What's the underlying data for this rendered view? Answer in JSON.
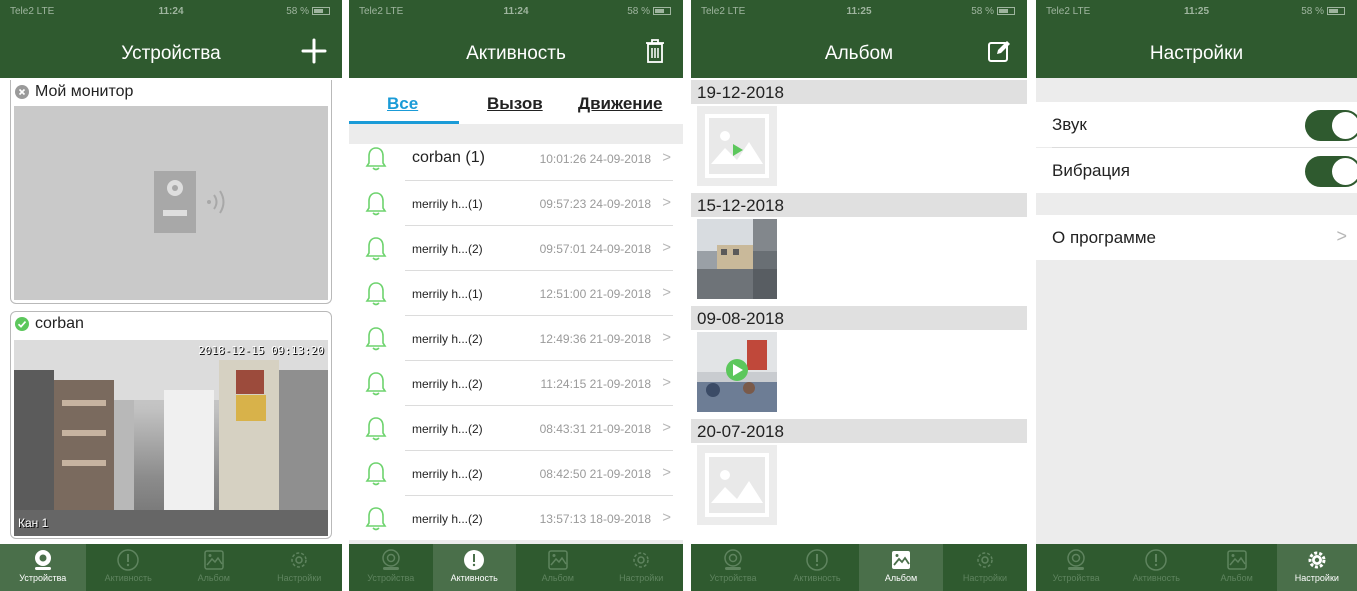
{
  "status_bar": {
    "carrier": "Tele2 LTE",
    "battery": "58 %"
  },
  "tabs": [
    "Устройства",
    "Активность",
    "Альбом",
    "Настройки"
  ],
  "colors": {
    "primary": "#2f5a2f",
    "tab_active": "#4a6f4a",
    "accent": "#1a9bd7",
    "bell": "#6ed36e",
    "online": "#5cc75c",
    "offline": "#9a9a9a"
  },
  "devices_screen": {
    "time": "11:24",
    "title": "Устройства",
    "add_icon": "plus-icon",
    "devices": [
      {
        "name": "Мой монитор",
        "status": "offline"
      },
      {
        "name": "corban",
        "status": "online",
        "timestamp": "2018-12-15 09:13:20",
        "channel": "Кан 1"
      }
    ]
  },
  "activity_screen": {
    "time": "11:24",
    "title": "Активность",
    "delete_icon": "trash-icon",
    "filters": [
      "Все",
      "Вызов",
      "Движение"
    ],
    "items": [
      {
        "name": "corban (1)",
        "time": "10:01:26 24-09-2018"
      },
      {
        "name": "merrily h...(1)",
        "time": "09:57:23 24-09-2018"
      },
      {
        "name": "merrily h...(2)",
        "time": "09:57:01 24-09-2018"
      },
      {
        "name": "merrily h...(1)",
        "time": "12:51:00 21-09-2018"
      },
      {
        "name": "merrily h...(2)",
        "time": "12:49:36 21-09-2018"
      },
      {
        "name": "merrily h...(2)",
        "time": "11:24:15 21-09-2018"
      },
      {
        "name": "merrily h...(2)",
        "time": "08:43:31 21-09-2018"
      },
      {
        "name": "merrily h...(2)",
        "time": "08:42:50 21-09-2018"
      },
      {
        "name": "merrily h...(2)",
        "time": "13:57:13 18-09-2018"
      }
    ]
  },
  "album_screen": {
    "time": "11:25",
    "title": "Альбом",
    "edit_icon": "edit-icon",
    "groups": [
      {
        "date": "19-12-2018",
        "thumb": "video-placeholder"
      },
      {
        "date": "15-12-2018",
        "thumb": "photo"
      },
      {
        "date": "09-08-2018",
        "thumb": "video"
      },
      {
        "date": "20-07-2018",
        "thumb": "image-placeholder"
      }
    ]
  },
  "settings_screen": {
    "time": "11:25",
    "title": "Настройки",
    "sound_label": "Звук",
    "sound_on": true,
    "vibration_label": "Вибрация",
    "vibration_on": true,
    "about_label": "О программе"
  }
}
